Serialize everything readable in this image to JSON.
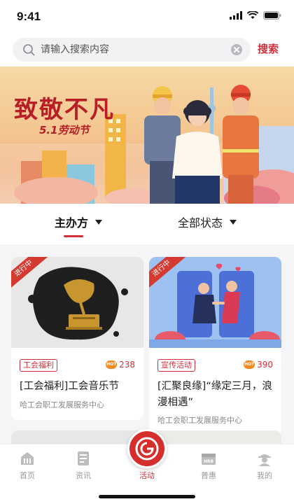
{
  "status_bar": {
    "time": "9:41"
  },
  "search": {
    "placeholder": "请输入搜索内容",
    "button_label": "搜索"
  },
  "banner": {
    "title": "致敬不凡",
    "subtitle": "5.1劳动节"
  },
  "filters": [
    {
      "label": "主办方",
      "active": true
    },
    {
      "label": "全部状态",
      "active": false
    }
  ],
  "cards": [
    {
      "status": "进行中",
      "tag": "工会福利",
      "heat": "238",
      "title": "[工会福利]工会音乐节",
      "organizer": "哈工会职工发展服务中心",
      "image": "gramophone-illustration"
    },
    {
      "status": "进行中",
      "tag": "宣传活动",
      "heat": "390",
      "title": "[汇聚良缘]“缘定三月，浪漫相遇”",
      "organizer": "哈工会职工发展服务中心",
      "image": "couple-illustration"
    }
  ],
  "tab_bar": {
    "items": [
      {
        "label": "首页",
        "icon": "home-icon"
      },
      {
        "label": "资讯",
        "icon": "news-icon"
      },
      {
        "label": "活动",
        "icon": "activity-icon",
        "active": true
      },
      {
        "label": "普惠",
        "icon": "benefit-icon"
      },
      {
        "label": "我的",
        "icon": "profile-icon"
      }
    ]
  },
  "colors": {
    "accent": "#d32f3a",
    "banner_bg": "#f4c792",
    "ribbon": "#d53a31"
  }
}
